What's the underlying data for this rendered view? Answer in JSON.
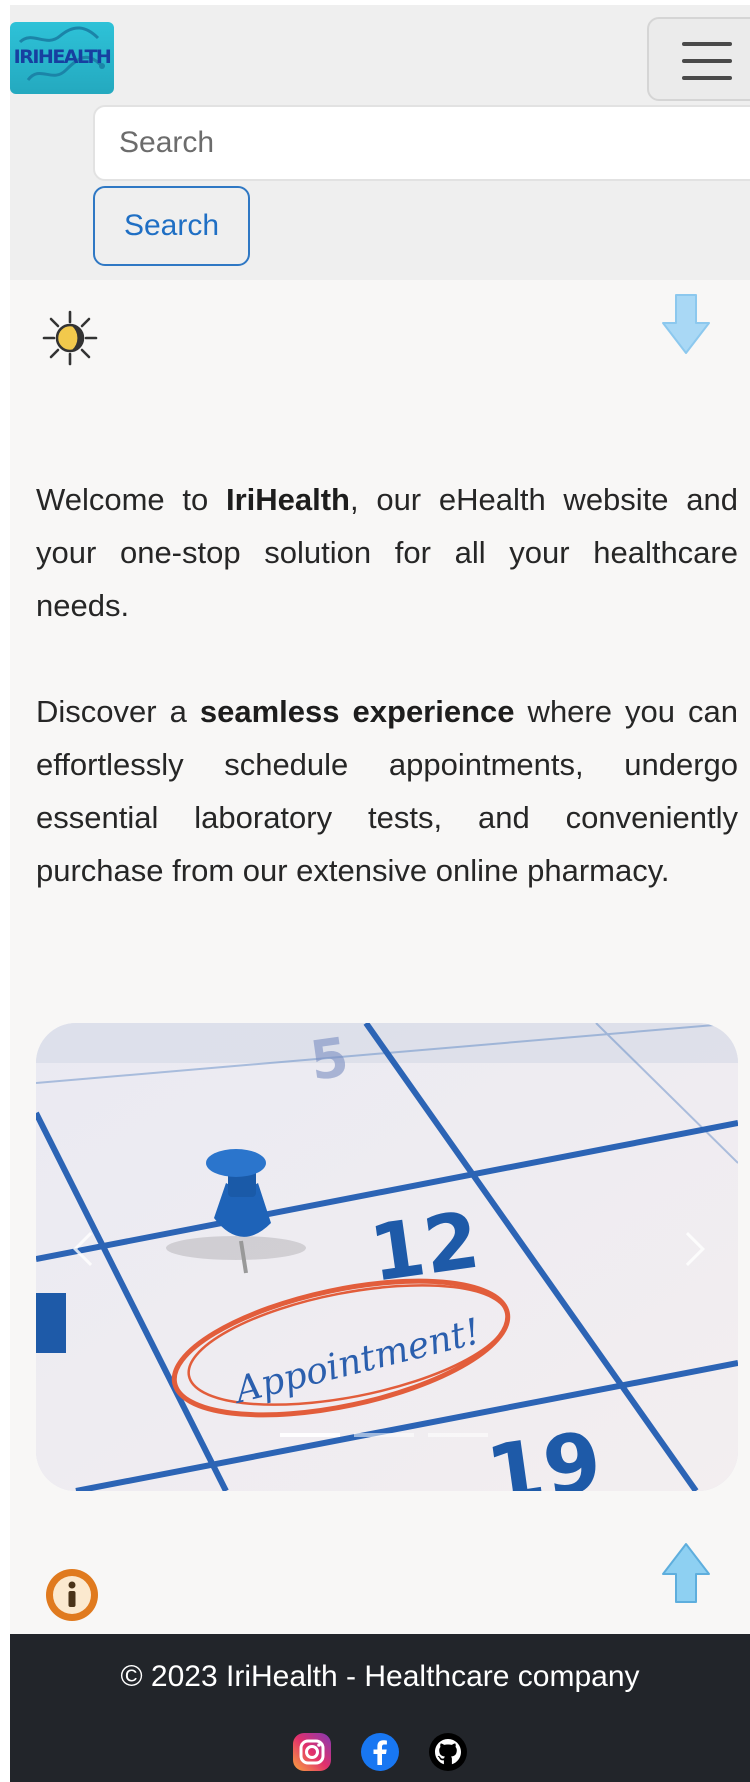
{
  "navbar": {
    "logo_text": "IRIHEALTH",
    "search": {
      "placeholder": "Search",
      "value": ""
    },
    "search_button_label": "Search"
  },
  "main": {
    "theme_icon": "sun-icon",
    "scroll_down_icon": "arrow-down-icon",
    "intro": {
      "p1_before": "Welcome to ",
      "p1_bold": "IriHealth",
      "p1_after": ", our eHealth website and your one-stop solution for all your healthcare needs.",
      "p2_before": "Discover a ",
      "p2_bold": "seamless experience",
      "p2_after": " where you can effortlessly schedule appointments, undergo essential laboratory tests, and conveniently purchase from our extensive online pharmacy."
    },
    "carousel": {
      "image_texts": {
        "top_number": "5",
        "day": "12",
        "bottom_number": "19",
        "note": "Appointment!"
      },
      "slide_count": 3,
      "active_slide": 1
    },
    "info_icon": "info-icon",
    "scroll_up_icon": "arrow-up-icon"
  },
  "footer": {
    "copyright": "© 2023 IriHealth - Healthcare company",
    "social": [
      "instagram-icon",
      "facebook-icon",
      "github-icon"
    ]
  },
  "colors": {
    "primary": "#1f6fc4",
    "footer_bg": "#22252a",
    "page_bg": "#f8f7f6",
    "navbar_bg": "#efefef",
    "logo_bg": "#2ec2d8"
  }
}
